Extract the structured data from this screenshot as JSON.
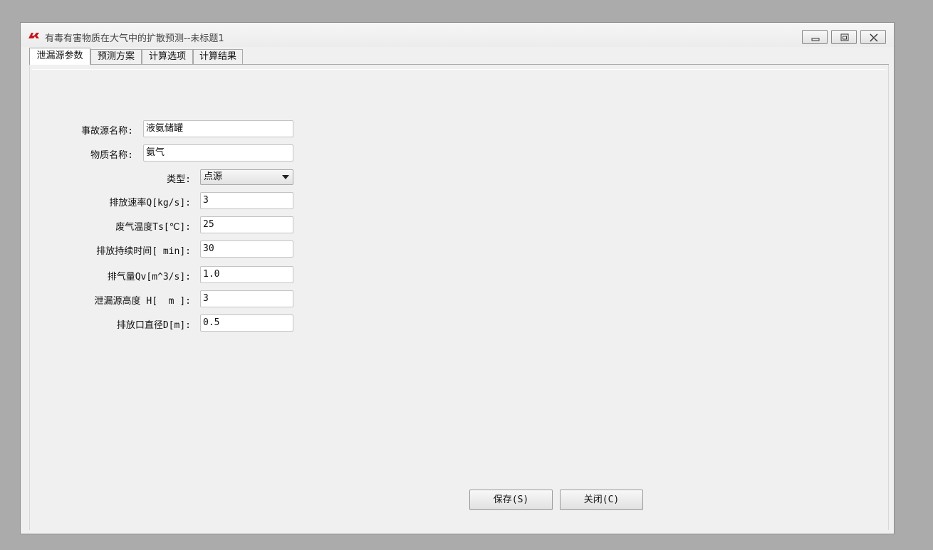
{
  "window": {
    "title": "有毒有害物质在大气中的扩散预测--未标题1",
    "icon": "rs-app-icon"
  },
  "tabs": [
    {
      "label": "泄漏源参数",
      "active": true
    },
    {
      "label": "预测方案",
      "active": false
    },
    {
      "label": "计算选项",
      "active": false
    },
    {
      "label": "计算结果",
      "active": false
    }
  ],
  "form": {
    "source_name": {
      "label": "事故源名称:",
      "value": "液氨储罐"
    },
    "substance_name": {
      "label": "物质名称:",
      "value": "氨气"
    },
    "type": {
      "label": "类型:",
      "value": "点源"
    },
    "emission_rate": {
      "label": "排放速率Q[kg/s]:",
      "value": "3"
    },
    "gas_temp": {
      "label": "废气温度Ts[℃]:",
      "value": "25"
    },
    "duration": {
      "label": "排放持续时间[ min]:",
      "value": "30"
    },
    "gas_volume": {
      "label": "排气量Qv[m^3/s]:",
      "value": "1.0"
    },
    "leak_height": {
      "label": "泄漏源高度 H[  m ]:",
      "value": "3"
    },
    "outlet_diameter": {
      "label": "排放口直径D[m]:",
      "value": "0.5"
    }
  },
  "buttons": {
    "save": "保存(S)",
    "close": "关闭(C)"
  },
  "colors": {
    "desktop": "#ababab",
    "window_bg": "#f0f0f0",
    "icon_red": "#c8141e"
  }
}
